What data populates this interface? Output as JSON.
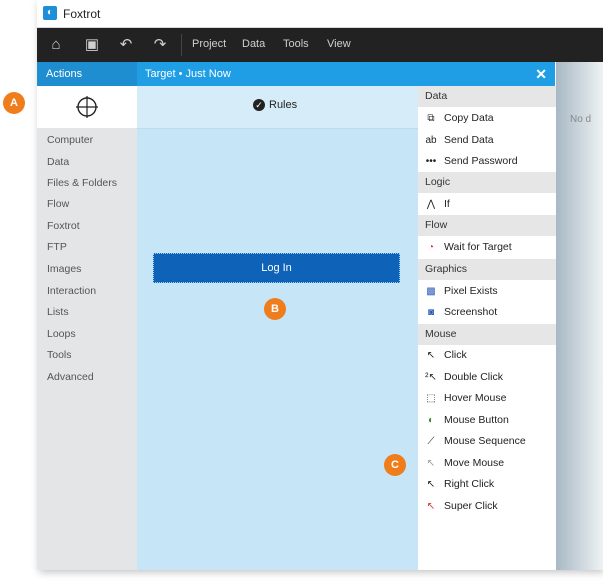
{
  "app": {
    "title": "Foxtrot",
    "logo_glyph": "◐"
  },
  "toolbar": {
    "icons": [
      "home-icon",
      "save-icon",
      "undo-icon",
      "redo-icon"
    ],
    "menu": [
      "Project",
      "Data",
      "Tools",
      "View"
    ]
  },
  "actions_header": "Actions",
  "target_header": {
    "title": "Target • Just Now",
    "close": "✕"
  },
  "categories": [
    "Computer",
    "Data",
    "Files & Folders",
    "Flow",
    "Foxtrot",
    "FTP",
    "Images",
    "Interaction",
    "Lists",
    "Loops",
    "Tools",
    "Advanced"
  ],
  "rules_label": "Rules",
  "login_button": "Log In",
  "callouts": {
    "a": "A",
    "b": "B",
    "c": "C"
  },
  "right_panel": {
    "sections": [
      {
        "label": "Data",
        "items": [
          "Copy Data",
          "Send Data",
          "Send Password"
        ]
      },
      {
        "label": "Logic",
        "items": [
          "If"
        ]
      },
      {
        "label": "Flow",
        "items": [
          "Wait for Target"
        ]
      },
      {
        "label": "Graphics",
        "items": [
          "Pixel Exists",
          "Screenshot"
        ]
      },
      {
        "label": "Mouse",
        "items": [
          "Click",
          "Double Click",
          "Hover Mouse",
          "Mouse Button",
          "Mouse Sequence",
          "Move Mouse",
          "Right Click",
          "Super Click"
        ]
      }
    ]
  },
  "faded_label": "No d",
  "colors": {
    "accent": "#1e8ed1",
    "login": "#0e62b8",
    "callout": "#f07d1c"
  }
}
